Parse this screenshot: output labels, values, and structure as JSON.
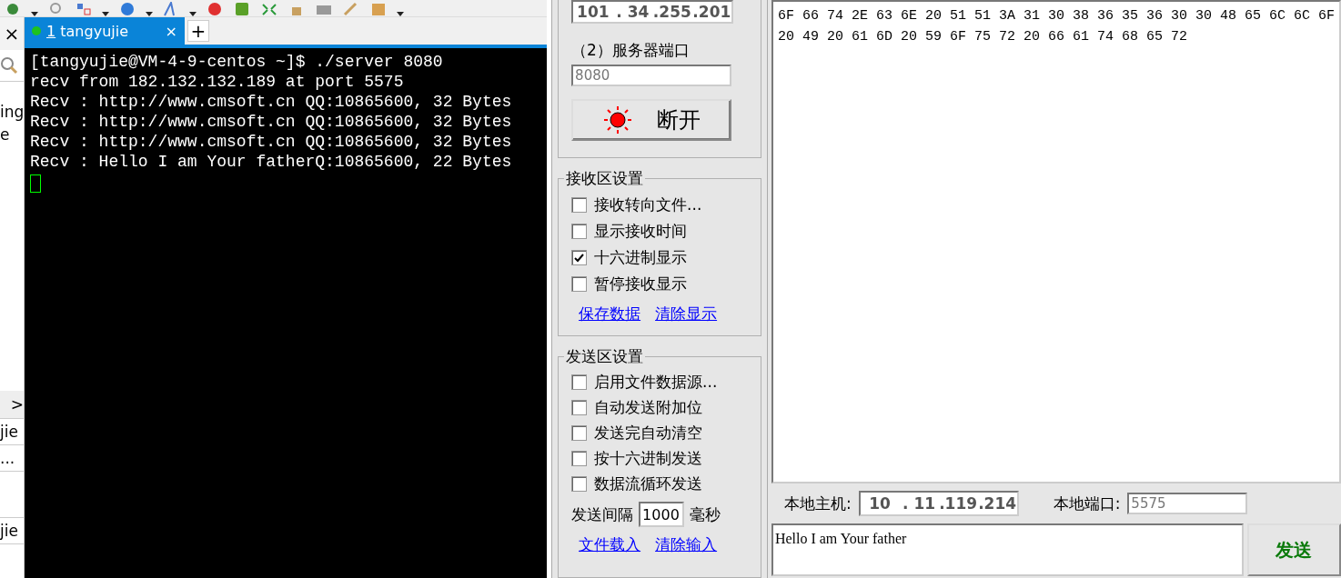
{
  "sidebar": {
    "close": "×",
    "texts": [
      {
        "kind": "text",
        "text": "ing"
      },
      {
        "kind": "text",
        "text": "e"
      },
      {
        "kind": "arrow",
        "text": ">"
      },
      {
        "kind": "text",
        "text": "jie"
      },
      {
        "kind": "text",
        "text": "..."
      },
      {
        "kind": "blank"
      },
      {
        "kind": "text",
        "text": "jie"
      }
    ]
  },
  "tab": {
    "index": "1",
    "label": "tangyujie",
    "close": "×",
    "add": "+",
    "selected": true
  },
  "terminal": {
    "lines": [
      "[tangyujie@VM-4-9-centos ~]$ ./server 8080",
      "recv from 182.132.132.189 at port 5575",
      "Recv : http://www.cmsoft.cn QQ:10865600, 32 Bytes",
      "Recv : http://www.cmsoft.cn QQ:10865600, 32 Bytes",
      "Recv : http://www.cmsoft.cn QQ:10865600, 32 Bytes",
      "Recv : Hello I am Your fatherQ:10865600, 22 Bytes"
    ]
  },
  "server": {
    "ip_segments": [
      "101",
      ". 34",
      ".255",
      ".201"
    ],
    "port_label": "（2）服务器端口",
    "port": "8080",
    "connect_button": "断开",
    "connected": true
  },
  "receive_settings": {
    "title": "接收区设置",
    "options": [
      {
        "label": "接收转向文件...",
        "checked": false
      },
      {
        "label": "显示接收时间",
        "checked": false
      },
      {
        "label": "十六进制显示",
        "checked": true
      },
      {
        "label": "暂停接收显示",
        "checked": false
      }
    ],
    "links": [
      "保存数据",
      "清除显示"
    ]
  },
  "send_settings": {
    "title": "发送区设置",
    "options": [
      {
        "label": "启用文件数据源...",
        "checked": false
      },
      {
        "label": "自动发送附加位",
        "checked": false
      },
      {
        "label": "发送完自动清空",
        "checked": false
      },
      {
        "label": "按十六进制发送",
        "checked": false
      },
      {
        "label": "数据流循环发送",
        "checked": false
      }
    ],
    "interval_label": "发送间隔",
    "interval": "1000",
    "interval_unit": "毫秒",
    "links": [
      "文件载入",
      "清除输入"
    ]
  },
  "receive_area": {
    "lines": [
      "6F 66 74 2E 63 6E 20 51 51 3A 31 30 38 36 35 36 30 30 48 65 6C 6C 6F",
      "20 49 20 61 6D 20 59 6F 75 72 20 66 61 74 68 65 72"
    ]
  },
  "local": {
    "host_label": "本地主机:",
    "host_segments": [
      "10",
      ". 11",
      ".119",
      ".214"
    ],
    "port_label": "本地端口:",
    "port": "5575"
  },
  "message": {
    "value": "Hello I am Your father",
    "send_button": "发送"
  }
}
